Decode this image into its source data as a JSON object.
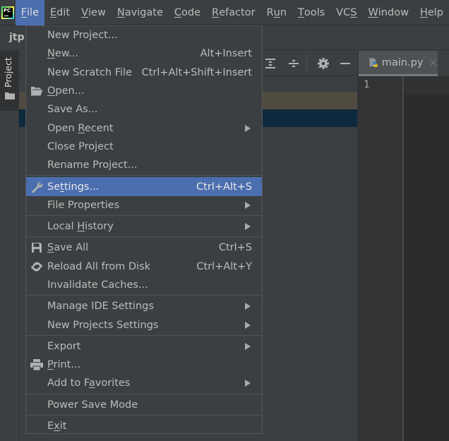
{
  "app": {
    "logo_text": "PC",
    "project_name": "jtp"
  },
  "menubar": {
    "items": [
      {
        "label_pre": "",
        "mnemonic": "F",
        "label_post": "ile",
        "active": true
      },
      {
        "label_pre": "",
        "mnemonic": "E",
        "label_post": "dit"
      },
      {
        "label_pre": "",
        "mnemonic": "V",
        "label_post": "iew"
      },
      {
        "label_pre": "",
        "mnemonic": "N",
        "label_post": "avigate"
      },
      {
        "label_pre": "",
        "mnemonic": "C",
        "label_post": "ode"
      },
      {
        "label_pre": "",
        "mnemonic": "R",
        "label_post": "efactor"
      },
      {
        "label_pre": "R",
        "mnemonic": "u",
        "label_post": "n"
      },
      {
        "label_pre": "",
        "mnemonic": "T",
        "label_post": "ools"
      },
      {
        "label_pre": "VC",
        "mnemonic": "S",
        "label_post": ""
      },
      {
        "label_pre": "",
        "mnemonic": "W",
        "label_post": "indow"
      },
      {
        "label_pre": "",
        "mnemonic": "H",
        "label_post": "elp"
      }
    ]
  },
  "sidebar": {
    "project_tab_label": "Project"
  },
  "project_panel": {
    "toolbar_icons": [
      "expand-all-icon",
      "collapse-all-icon",
      "gear-icon",
      "minimize-icon"
    ]
  },
  "editor": {
    "tab_label": "main.py",
    "line_numbers": [
      "1"
    ]
  },
  "file_menu": {
    "groups": [
      [
        {
          "pre": "New Project...",
          "mn": "",
          "post": "",
          "shortcut": "",
          "submenu": false,
          "icon": ""
        },
        {
          "pre": "",
          "mn": "N",
          "post": "ew...",
          "shortcut": "Alt+Insert",
          "submenu": false,
          "icon": ""
        },
        {
          "pre": "New Scratch File",
          "mn": "",
          "post": "",
          "shortcut": "Ctrl+Alt+Shift+Insert",
          "submenu": false,
          "icon": ""
        },
        {
          "pre": "",
          "mn": "O",
          "post": "pen...",
          "shortcut": "",
          "submenu": false,
          "icon": "folder-open-icon"
        },
        {
          "pre": "Save As...",
          "mn": "",
          "post": "",
          "shortcut": "",
          "submenu": false,
          "icon": ""
        },
        {
          "pre": "Open ",
          "mn": "R",
          "post": "ecent",
          "shortcut": "",
          "submenu": true,
          "icon": ""
        },
        {
          "pre": "Close Project",
          "mn": "",
          "post": "",
          "shortcut": "",
          "submenu": false,
          "icon": ""
        },
        {
          "pre": "Rename Project...",
          "mn": "",
          "post": "",
          "shortcut": "",
          "submenu": false,
          "icon": ""
        }
      ],
      [
        {
          "pre": "Se",
          "mn": "t",
          "post": "tings...",
          "shortcut": "Ctrl+Alt+S",
          "submenu": false,
          "icon": "wrench-icon",
          "selected": true
        },
        {
          "pre": "File Properties",
          "mn": "",
          "post": "",
          "shortcut": "",
          "submenu": true,
          "icon": ""
        }
      ],
      [
        {
          "pre": "Local ",
          "mn": "H",
          "post": "istory",
          "shortcut": "",
          "submenu": true,
          "icon": ""
        }
      ],
      [
        {
          "pre": "",
          "mn": "S",
          "post": "ave All",
          "shortcut": "Ctrl+S",
          "submenu": false,
          "icon": "save-icon"
        },
        {
          "pre": "Reload All from Disk",
          "mn": "",
          "post": "",
          "shortcut": "Ctrl+Alt+Y",
          "submenu": false,
          "icon": "reload-icon"
        },
        {
          "pre": "Invalidate Caches...",
          "mn": "",
          "post": "",
          "shortcut": "",
          "submenu": false,
          "icon": ""
        }
      ],
      [
        {
          "pre": "Manage IDE Settings",
          "mn": "",
          "post": "",
          "shortcut": "",
          "submenu": true,
          "icon": ""
        },
        {
          "pre": "New Projects Settings",
          "mn": "",
          "post": "",
          "shortcut": "",
          "submenu": true,
          "icon": ""
        }
      ],
      [
        {
          "pre": "Export",
          "mn": "",
          "post": "",
          "shortcut": "",
          "submenu": true,
          "icon": ""
        },
        {
          "pre": "",
          "mn": "P",
          "post": "rint...",
          "shortcut": "",
          "submenu": false,
          "icon": "print-icon"
        },
        {
          "pre": "Add to F",
          "mn": "a",
          "post": "vorites",
          "shortcut": "",
          "submenu": true,
          "icon": ""
        }
      ],
      [
        {
          "pre": "Power Save Mode",
          "mn": "",
          "post": "",
          "shortcut": "",
          "submenu": false,
          "icon": ""
        }
      ],
      [
        {
          "pre": "E",
          "mn": "x",
          "post": "it",
          "shortcut": "",
          "submenu": false,
          "icon": ""
        }
      ]
    ]
  }
}
